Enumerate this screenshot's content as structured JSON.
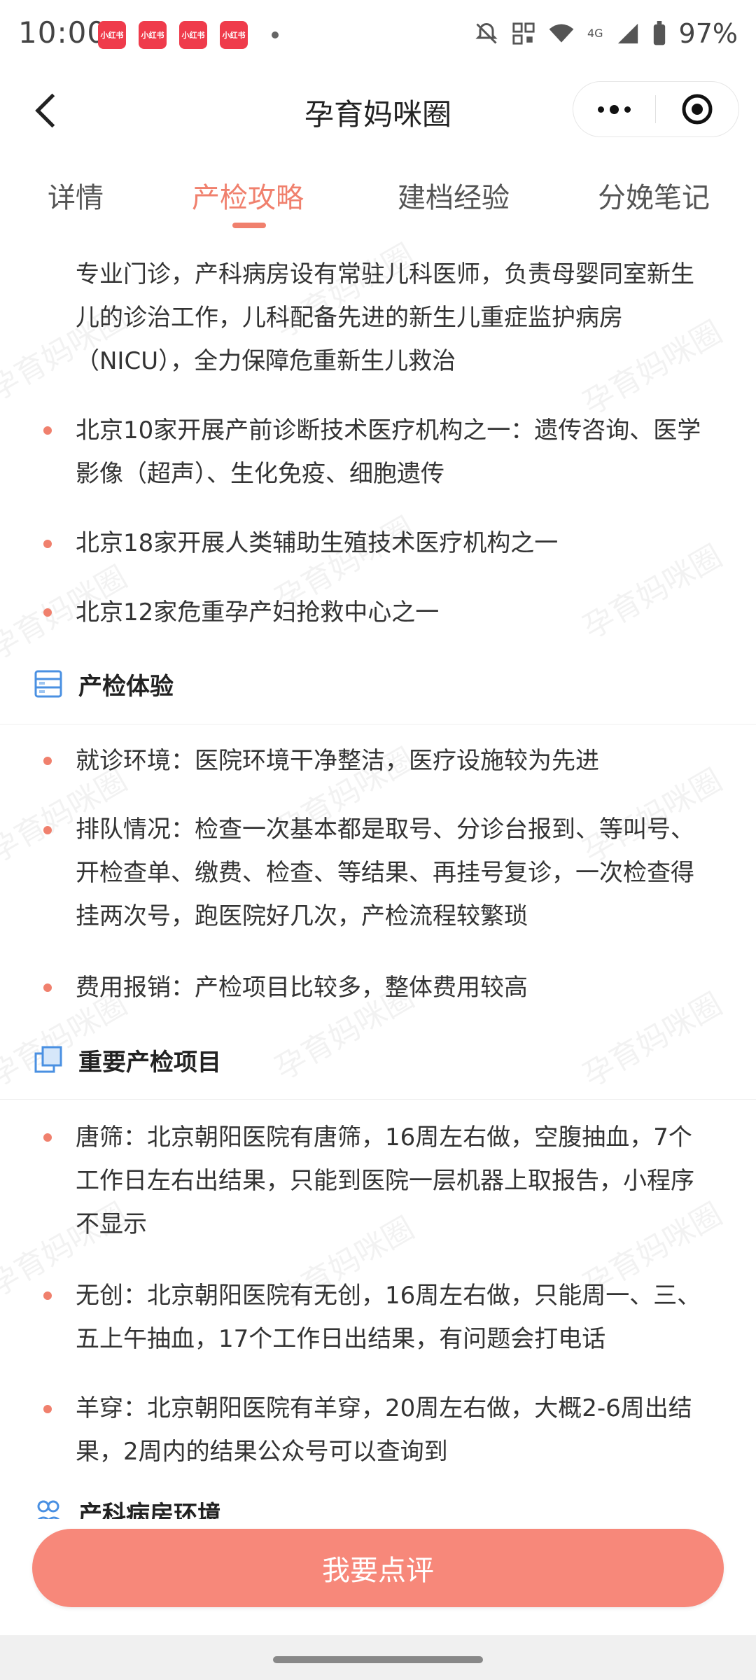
{
  "status_bar": {
    "time": "10:00",
    "app_badges": [
      "小红书",
      "小红书",
      "小红书",
      "小红书"
    ],
    "network": "4G",
    "battery": "97%"
  },
  "nav": {
    "title": "孕育妈咪圈",
    "icons": {
      "back": "chevron-left-icon",
      "more": "more-dots-icon",
      "close": "record-circle-icon"
    }
  },
  "tabs": [
    {
      "label": "详情",
      "active": false
    },
    {
      "label": "产检攻略",
      "active": true
    },
    {
      "label": "建档经验",
      "active": false
    },
    {
      "label": "分娩笔记",
      "active": false
    }
  ],
  "content": {
    "intro_lines": [
      "专业门诊，产科病房设有常驻儿科医师，负责母婴同室新生",
      "儿的诊治工作，儿科配备先进的新生儿重症监护病房",
      "（NICU），全力保障危重新生儿救治"
    ],
    "facility_bullets": [
      [
        "北京10家开展产前诊断技术医疗机构之一：遗传咨询、医学",
        "影像（超声）、生化免疫、细胞遗传"
      ],
      [
        "北京18家开展人类辅助生殖技术医疗机构之一"
      ],
      [
        "北京12家危重孕产妇抢救中心之一"
      ]
    ],
    "section_experience": {
      "title": "产检体验",
      "icon": "list-document-icon",
      "bullets": [
        [
          "就诊环境：医院环境干净整洁，医疗设施较为先进"
        ],
        [
          "排队情况：检查一次基本都是取号、分诊台报到、等叫号、",
          "开检查单、缴费、检查、等结果、再挂号复诊，一次检查得",
          "挂两次号，跑医院好几次，产检流程较繁琐"
        ],
        [
          "费用报销：产检项目比较多，整体费用较高"
        ]
      ]
    },
    "section_items": {
      "title": "重要产检项目",
      "icon": "layers-icon",
      "bullets": [
        [
          "唐筛：北京朝阳医院有唐筛，16周左右做，空腹抽血，7个",
          "工作日左右出结果，只能到医院一层机器上取报告，小程序",
          "不显示"
        ],
        [
          "无创：北京朝阳医院有无创，16周左右做，只能周一、三、",
          "五上午抽血，17个工作日出结果，有问题会打电话"
        ],
        [
          "羊穿：北京朝阳医院有羊穿，20周左右做，大概2-6周出结",
          "果，2周内的结果公众号可以查询到"
        ]
      ]
    },
    "section_ward": {
      "title": "产科病房环境",
      "icon": "people-icon"
    },
    "watermark": "孕育妈咪圈"
  },
  "cta": {
    "label": "我要点评"
  },
  "colors": {
    "accent": "#f0806d",
    "cta_bg": "#f7887a",
    "bullet": "#f0806d",
    "icon_blue": "#4a90e2"
  }
}
